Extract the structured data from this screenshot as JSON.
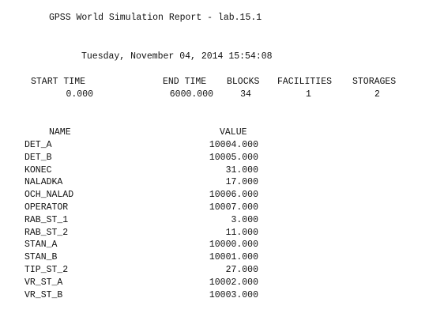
{
  "report": {
    "title": "GPSS World Simulation Report - lab.15.1",
    "date": "Tuesday, November 04, 2014 15:54:08"
  },
  "summary": {
    "headers": {
      "start_time": "START TIME",
      "end_time": "END TIME",
      "blocks": "BLOCKS",
      "facilities": "FACILITIES",
      "storages": "STORAGES"
    },
    "values": {
      "start_time": "0.000",
      "end_time": "6000.000",
      "blocks": "34",
      "facilities": "1",
      "storages": "2"
    }
  },
  "names_table": {
    "headers": {
      "name": "NAME",
      "value": "VALUE"
    },
    "rows": [
      {
        "name": "DET_A",
        "value": "10004.000"
      },
      {
        "name": "DET_B",
        "value": "10005.000"
      },
      {
        "name": "KONEC",
        "value": "31.000"
      },
      {
        "name": "NALADKA",
        "value": "17.000"
      },
      {
        "name": "OCH_NALAD",
        "value": "10006.000"
      },
      {
        "name": "OPERATOR",
        "value": "10007.000"
      },
      {
        "name": "RAB_ST_1",
        "value": "3.000"
      },
      {
        "name": "RAB_ST_2",
        "value": "11.000"
      },
      {
        "name": "STAN_A",
        "value": "10000.000"
      },
      {
        "name": "STAN_B",
        "value": "10001.000"
      },
      {
        "name": "TIP_ST_2",
        "value": "27.000"
      },
      {
        "name": "VR_ST_A",
        "value": "10002.000"
      },
      {
        "name": "VR_ST_B",
        "value": "10003.000"
      }
    ]
  }
}
